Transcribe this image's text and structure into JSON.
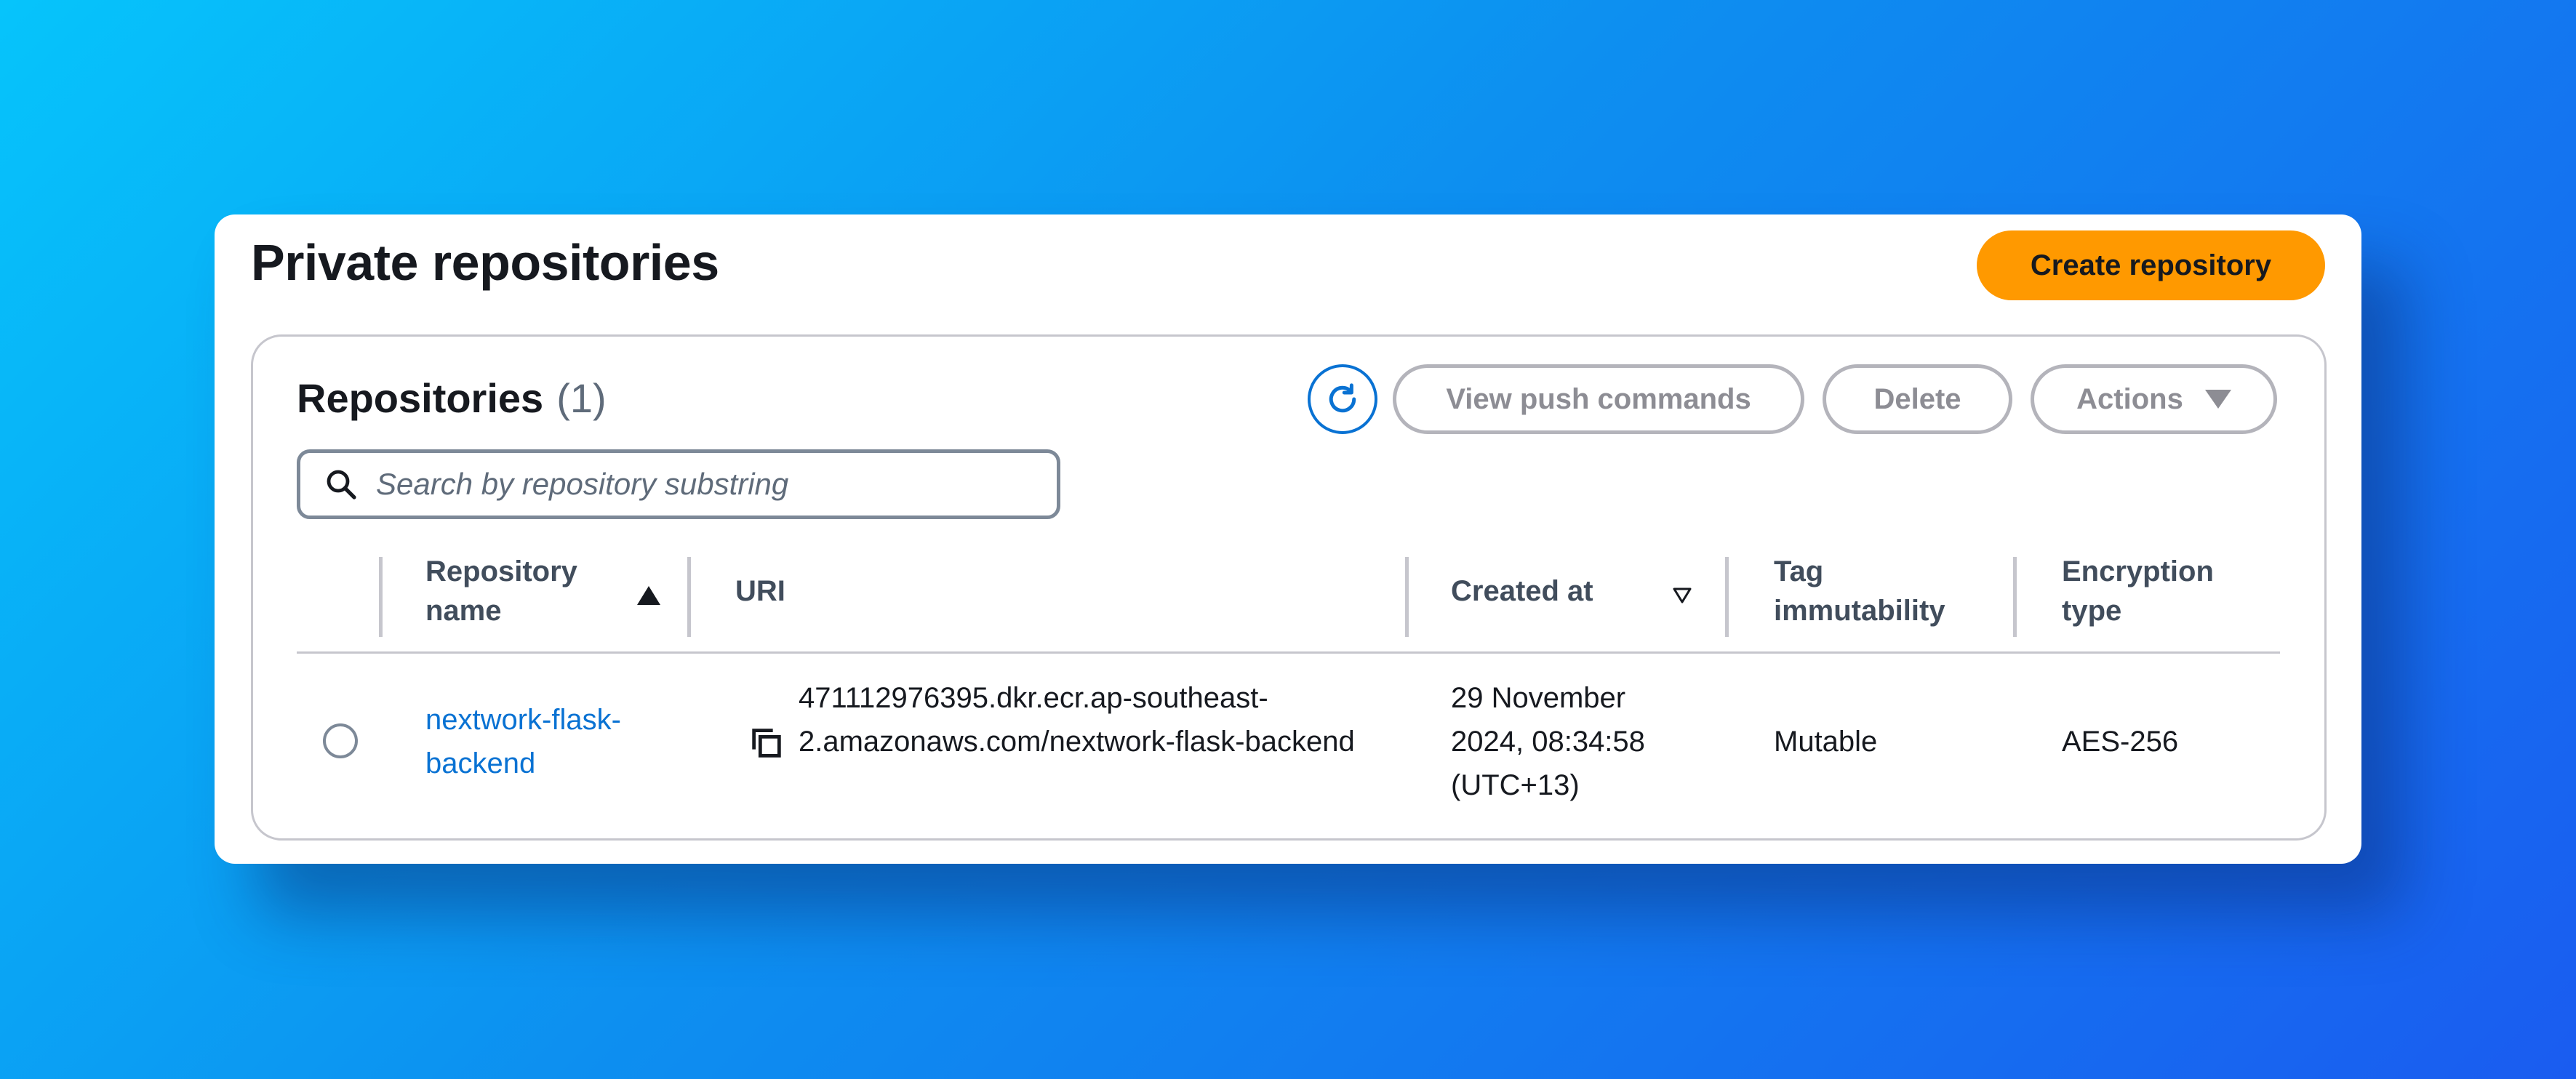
{
  "header": {
    "title": "Private repositories",
    "create_label": "Create repository"
  },
  "repositories": {
    "title": "Repositories",
    "count": "(1)",
    "refresh_icon": "refresh-icon",
    "view_push_label": "View push commands",
    "delete_label": "Delete",
    "actions_label": "Actions"
  },
  "search": {
    "placeholder": "Search by repository substring",
    "value": ""
  },
  "table": {
    "columns": {
      "name": "Repository name",
      "uri": "URI",
      "created": "Created at",
      "tag": "Tag immutability",
      "encryption": "Encryption type"
    },
    "rows": [
      {
        "name": "nextwork-flask-backend",
        "uri": "471112976395.dkr.ecr.ap-southeast-2.amazonaws.com/nextwork-flask-backend",
        "created": "29 November 2024, 08:34:58 (UTC+13)",
        "tag": "Mutable",
        "encryption": "AES-256"
      }
    ]
  },
  "colors": {
    "accent": "#ff9900",
    "link": "#0972d3",
    "border": "#c6c6cd"
  }
}
